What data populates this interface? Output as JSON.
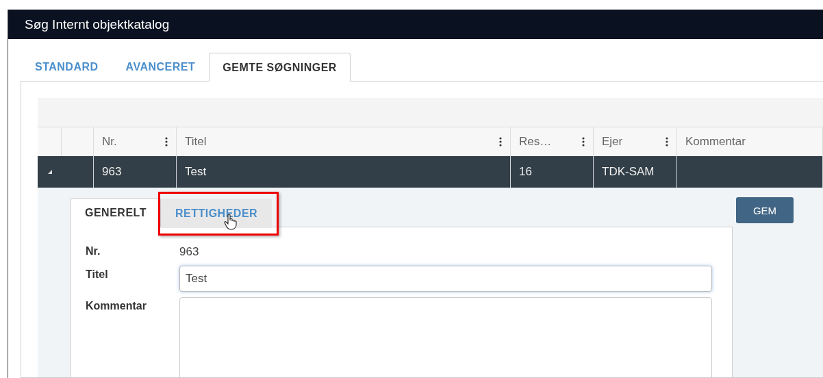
{
  "window": {
    "title": "Søg Internt objektkatalog"
  },
  "tabs": [
    {
      "label": "STANDARD",
      "selected": false
    },
    {
      "label": "AVANCERET",
      "selected": false
    },
    {
      "label": "GEMTE SØGNINGER",
      "selected": true
    }
  ],
  "grid": {
    "columns": [
      {
        "label": "Nr.",
        "menu": true
      },
      {
        "label": "Titel",
        "menu": true
      },
      {
        "label": "Res…",
        "menu": true
      },
      {
        "label": "Ejer",
        "menu": true
      },
      {
        "label": "Kommentar",
        "menu": false
      }
    ],
    "rows": [
      {
        "expanded": true,
        "selected": true,
        "cells": [
          "963",
          "Test",
          "16",
          "TDK-SAM",
          null
        ]
      }
    ]
  },
  "detail": {
    "tabs": [
      {
        "label": "GENERELT",
        "selected": true,
        "highlighted": false
      },
      {
        "label": "RETTIGHEDER",
        "selected": false,
        "highlighted": true
      }
    ],
    "fields": [
      {
        "kind": "text",
        "label": "Nr.",
        "value": "963"
      },
      {
        "kind": "input",
        "label": "Titel",
        "value": "Test"
      },
      {
        "kind": "textarea",
        "label": "Kommentar"
      }
    ],
    "button": "GEM"
  }
}
